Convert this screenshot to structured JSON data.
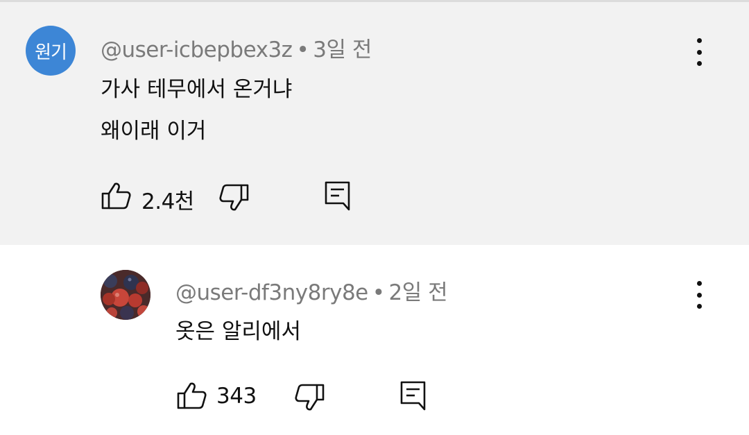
{
  "comments": [
    {
      "avatar_label": "원기",
      "avatar_color": "#3d86d6",
      "handle": "@user-icbepbex3z",
      "separator": "•",
      "time": "3일 전",
      "lines": [
        "가사 테무에서 온거냐",
        "왜이래 이거"
      ],
      "like_count": "2.4천",
      "background": "#f2f2f2"
    },
    {
      "avatar_icon": "berries-photo-avatar",
      "handle": "@user-df3ny8ry8e",
      "separator": "•",
      "time": "2일 전",
      "lines": [
        "옷은 알리에서"
      ],
      "like_count": "343",
      "background": "#ffffff"
    }
  ],
  "icons": {
    "like": "thumbs-up-icon",
    "dislike": "thumbs-down-icon",
    "reply": "reply-comment-icon",
    "more": "more-vertical-icon"
  }
}
